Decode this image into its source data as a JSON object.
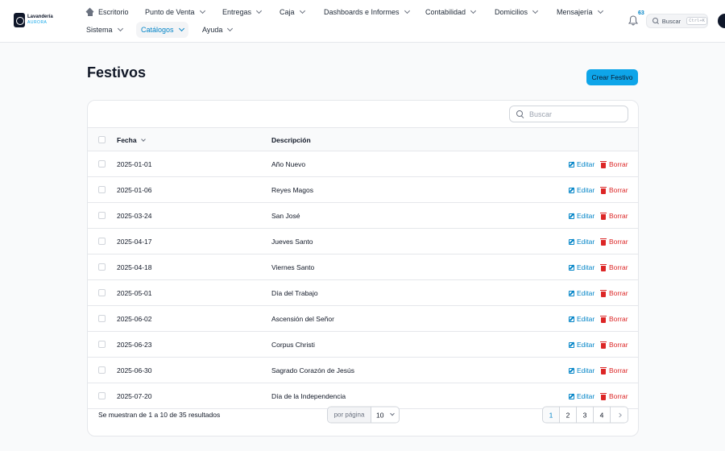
{
  "app": {
    "logo_name": "Lavandería",
    "logo_sub": "AURORA"
  },
  "nav": {
    "row1": [
      {
        "label": "Escritorio",
        "icon": "home-icon"
      },
      {
        "label": "Punto de Venta"
      },
      {
        "label": "Entregas"
      },
      {
        "label": "Caja"
      },
      {
        "label": "Dashboards e Informes"
      },
      {
        "label": "Contabilidad"
      },
      {
        "label": "Domicilios"
      },
      {
        "label": "Mensajería"
      }
    ],
    "row2": [
      {
        "label": "Sistema"
      },
      {
        "label": "Catálogos",
        "active": true
      },
      {
        "label": "Ayuda"
      }
    ],
    "notifications_count": "63",
    "search_label": "Buscar",
    "search_shortcut": "Ctrl+K"
  },
  "page": {
    "title": "Festivos",
    "create_button": "Crear Festivo"
  },
  "table": {
    "search_placeholder": "Buscar",
    "columns": {
      "date": "Fecha",
      "description": "Descripción"
    },
    "edit_label": "Editar",
    "delete_label": "Borrar",
    "rows": [
      {
        "date": "2025-01-01",
        "description": "Año Nuevo"
      },
      {
        "date": "2025-01-06",
        "description": "Reyes Magos"
      },
      {
        "date": "2025-03-24",
        "description": "San José"
      },
      {
        "date": "2025-04-17",
        "description": "Jueves Santo"
      },
      {
        "date": "2025-04-18",
        "description": "Viernes Santo"
      },
      {
        "date": "2025-05-01",
        "description": "Día del Trabajo"
      },
      {
        "date": "2025-06-02",
        "description": "Ascensión del Señor"
      },
      {
        "date": "2025-06-23",
        "description": "Corpus Christi"
      },
      {
        "date": "2025-06-30",
        "description": "Sagrado Corazón de Jesús"
      },
      {
        "date": "2025-07-20",
        "description": "Día de la Independencia"
      }
    ]
  },
  "footer": {
    "summary": "Se muestran de 1 a 10 de 35 resultados",
    "per_page_label": "por página",
    "per_page_value": "10",
    "pages": [
      "1",
      "2",
      "3",
      "4"
    ],
    "current_page": "1"
  },
  "colors": {
    "accent": "#0ea5e9",
    "link": "#0284c7",
    "danger": "#dc2626"
  }
}
